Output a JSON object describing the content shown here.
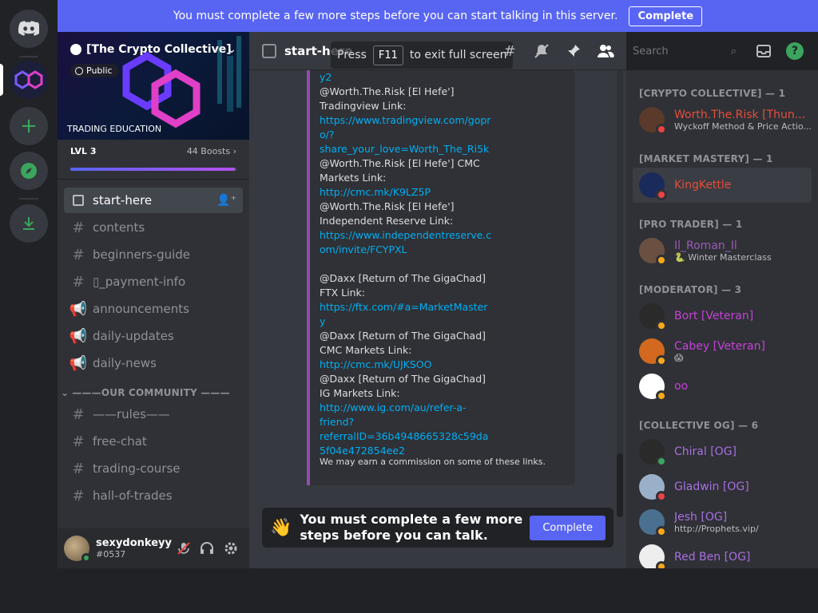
{
  "banner": {
    "text": "You must complete a few more steps before you can start talking in this server.",
    "button": "Complete"
  },
  "server": {
    "name": "[The Crypto Collective]",
    "visibility": "Public",
    "tagline": "TRADING EDUCATION",
    "level": "LVL 3",
    "boosts": "44 Boosts",
    "boost_progress": 0.99
  },
  "channels": [
    {
      "name": "start-here",
      "type": "rules",
      "active": true
    },
    {
      "name": "contents",
      "type": "text"
    },
    {
      "name": "beginners-guide",
      "type": "text"
    },
    {
      "name": "▯_payment-info",
      "type": "text"
    },
    {
      "name": "announcements",
      "type": "announce"
    },
    {
      "name": "daily-updates",
      "type": "announce"
    },
    {
      "name": "daily-news",
      "type": "announce"
    }
  ],
  "category": "———OUR COMMUNITY ———",
  "channels2": [
    {
      "name": "——rules——"
    },
    {
      "name": "free-chat"
    },
    {
      "name": "trading-course"
    },
    {
      "name": "hall-of-trades"
    }
  ],
  "user": {
    "name": "sexydonkeyy",
    "tag": "#0537"
  },
  "chat": {
    "channel": "start-here",
    "fullscreen_press": "Press",
    "fullscreen_key": "F11",
    "fullscreen_text": "to exit full screen",
    "lines": [
      {
        "t": "y2",
        "link": true
      },
      {
        "t": "@Worth.The.Risk [El Hefe']"
      },
      {
        "t": "Tradingview Link:"
      },
      {
        "t": "https://www.tradingview.com/gopr",
        "link": true
      },
      {
        "t": "o/?",
        "link": true
      },
      {
        "t": "share_your_love=Worth_The_Ri5k",
        "link": true
      },
      {
        "t": "@Worth.The.Risk [El Hefe'] CMC"
      },
      {
        "t": "Markets Link:"
      },
      {
        "t": "http://cmc.mk/K9LZ5P",
        "link": true
      },
      {
        "t": "@Worth.The.Risk [El Hefe']"
      },
      {
        "t": "Independent Reserve Link:"
      },
      {
        "t": "https://www.independentreserve.c",
        "link": true
      },
      {
        "t": "om/invite/FCYPXL",
        "link": true
      },
      {
        "t": ""
      },
      {
        "t": "@Daxx [Return of The GigaChad]"
      },
      {
        "t": "FTX Link:"
      },
      {
        "t": "https://ftx.com/#a=MarketMaster",
        "link": true
      },
      {
        "t": "y",
        "link": true
      },
      {
        "t": "@Daxx [Return of The GigaChad]"
      },
      {
        "t": "CMC Markets Link:"
      },
      {
        "t": "http://cmc.mk/UJKSOO",
        "link": true
      },
      {
        "t": "@Daxx [Return of The GigaChad]"
      },
      {
        "t": "IG Markets Link:"
      },
      {
        "t": "http://www.ig.com/au/refer-a-",
        "link": true
      },
      {
        "t": "friend?",
        "link": true
      },
      {
        "t": "referralID=36b4948665328c59da",
        "link": true
      },
      {
        "t": "5f04e472854ee2",
        "link": true
      }
    ],
    "footer": "We may earn a commission on some of these links.",
    "complete_text": "You must complete a few more steps before you can talk.",
    "complete_button": "Complete",
    "complete_emoji": "👋"
  },
  "header": {
    "search_placeholder": "Search"
  },
  "members": [
    {
      "role": "[CRYPTO COLLECTIVE] — 1",
      "people": [
        {
          "name": "Worth.The.Risk [Thun...",
          "status_text": "Wyckoff Method & Price Actio...",
          "color": "#e74c3c",
          "status": "dnd",
          "avatar": "#5a3a2a"
        }
      ]
    },
    {
      "role": "[MARKET MASTERY] — 1",
      "people": [
        {
          "name": "KingKettle",
          "status_text": "",
          "color": "#e74c3c",
          "status": "dnd",
          "avatar": "#1a2a5a",
          "highlight": true
        }
      ]
    },
    {
      "role": "[PRO TRADER] — 1",
      "people": [
        {
          "name": "Il_Roman_Il",
          "status_text": "🐍 Winter Masterclass",
          "color": "#9b59b6",
          "status": "idle",
          "avatar": "#6a5040"
        }
      ]
    },
    {
      "role": "[MODERATOR] — 3",
      "people": [
        {
          "name": "Bort [Veteran]",
          "status_text": "",
          "color": "#c542d6",
          "status": "idle",
          "avatar": "#2a2a2a"
        },
        {
          "name": "Cabey [Veteran]",
          "status_text": "😱",
          "color": "#c542d6",
          "status": "idle",
          "avatar": "#d2691e"
        },
        {
          "name": "oo",
          "status_text": "",
          "color": "#c542d6",
          "status": "idle",
          "avatar": "#ffffff"
        }
      ]
    },
    {
      "role": "[COLLECTIVE OG] — 6",
      "people": [
        {
          "name": "Chiral [OG]",
          "status_text": "",
          "color": "#a96fe0",
          "status": "online",
          "avatar": "#2a2a2a"
        },
        {
          "name": "Gladwin [OG]",
          "status_text": "",
          "color": "#a96fe0",
          "status": "dnd",
          "avatar": "#9ab0c8"
        },
        {
          "name": "Jesh [OG]",
          "status_text": "http://Prophets.vip/",
          "color": "#a96fe0",
          "status": "idle",
          "avatar": "#4a7090"
        },
        {
          "name": "Red Ben [OG]",
          "status_text": "",
          "color": "#a96fe0",
          "status": "idle",
          "avatar": "#eeeeee"
        }
      ]
    }
  ],
  "colors": {
    "online": "#3ba55d",
    "idle": "#faa81a",
    "dnd": "#ed4245",
    "accent": "#5865f2"
  }
}
